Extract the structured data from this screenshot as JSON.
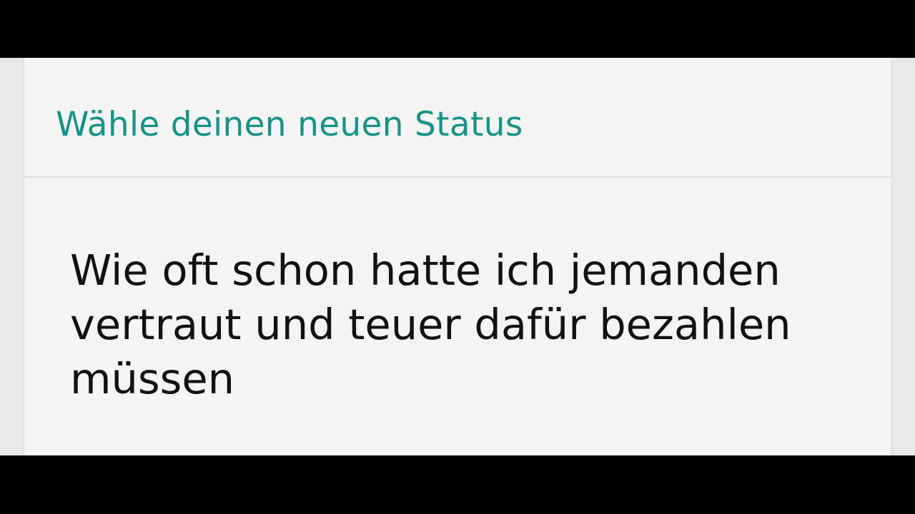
{
  "dialog": {
    "title": "Wähle deinen neuen Status",
    "title_color": "#169384",
    "options": [
      {
        "text": "Wie oft schon hatte ich jemanden vertraut und teuer dafür bezahlen müssen"
      }
    ]
  }
}
